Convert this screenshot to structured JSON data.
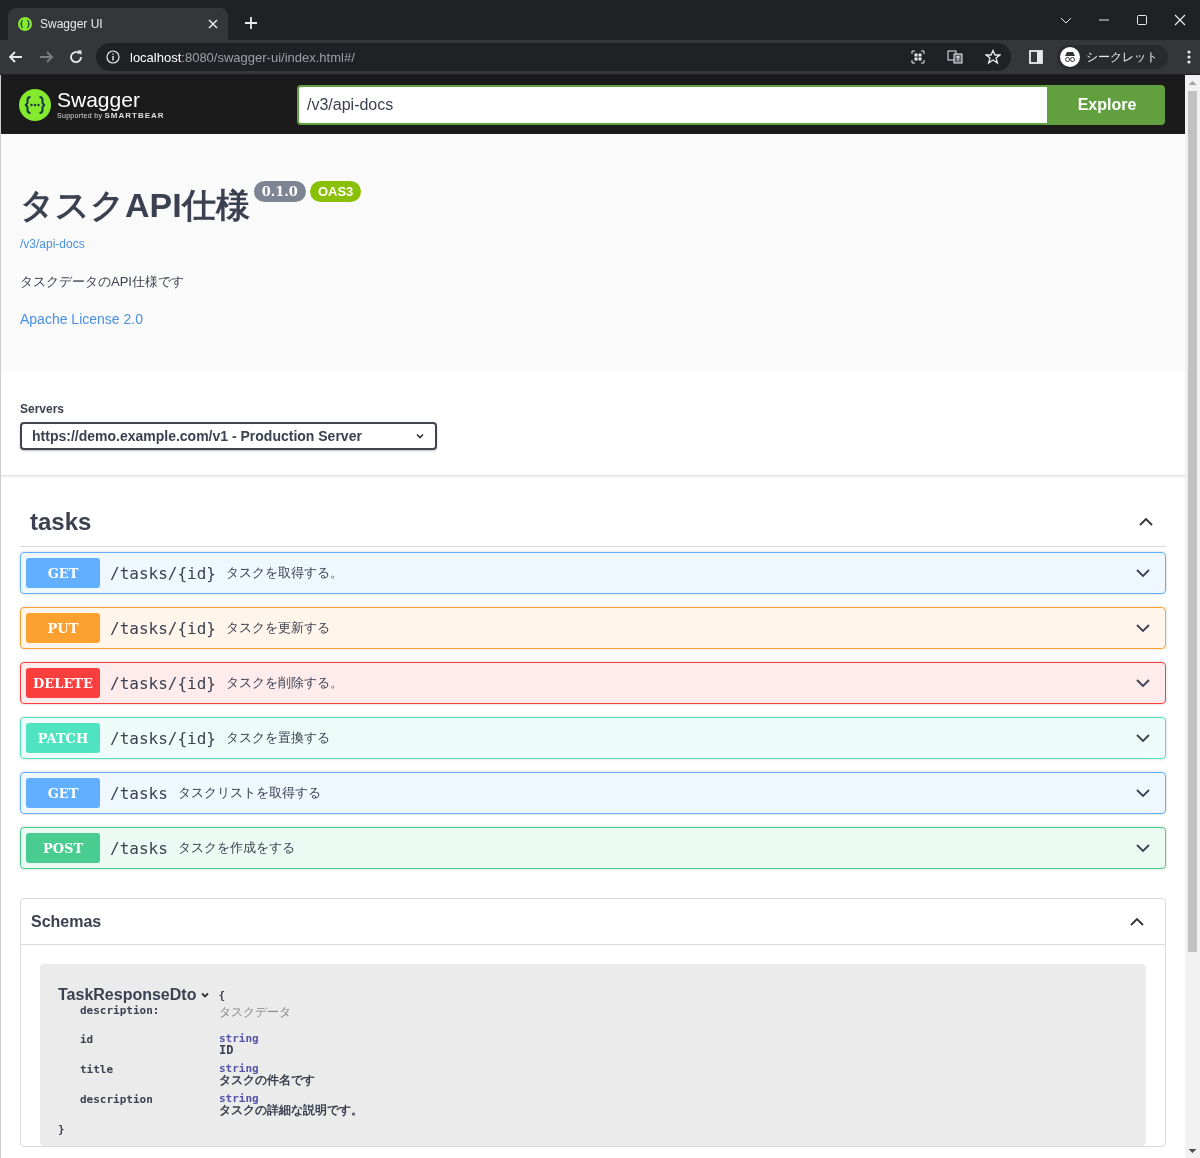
{
  "browser": {
    "tabs": [
      {
        "title": "Swagger UI",
        "selected": true
      }
    ],
    "url": {
      "host": "localhost",
      "path": ":8080/swagger-ui/index.html#/"
    },
    "profile_label": "シークレット"
  },
  "topbar": {
    "logo_text": "Swagger",
    "logo_sub": "Supported by",
    "logo_brand": "SMARTBEAR",
    "url_value": "/v3/api-docs",
    "button": "Explore"
  },
  "info": {
    "title": "タスクAPI仕様",
    "version": "0.1.0",
    "oas": "OAS3",
    "spec_link": "/v3/api-docs",
    "description": "タスクデータのAPI仕様です",
    "license": "Apache License 2.0"
  },
  "servers": {
    "label": "Servers",
    "selected": "https://demo.example.com/v1 - Production Server"
  },
  "tags": [
    {
      "name": "tasks",
      "expanded": true,
      "operations": [
        {
          "method": "GET",
          "color": "#61affe",
          "path": "/tasks/{id}",
          "summary": "タスクを取得する。"
        },
        {
          "method": "PUT",
          "color": "#fca130",
          "path": "/tasks/{id}",
          "summary": "タスクを更新する"
        },
        {
          "method": "DELETE",
          "color": "#f93e3e",
          "path": "/tasks/{id}",
          "summary": "タスクを削除する。"
        },
        {
          "method": "PATCH",
          "color": "#50e3c2",
          "path": "/tasks/{id}",
          "summary": "タスクを置換する"
        },
        {
          "method": "GET",
          "color": "#61affe",
          "path": "/tasks",
          "summary": "タスクリストを取得する"
        },
        {
          "method": "POST",
          "color": "#49cc90",
          "path": "/tasks",
          "summary": "タスクを作成をする"
        }
      ]
    }
  ],
  "schemas": {
    "title": "Schemas",
    "expanded": true,
    "models": [
      {
        "name": "TaskResponseDto",
        "expanded": true,
        "open": "{",
        "close": "}",
        "description_label": "description:",
        "description": "タスクデータ",
        "properties": [
          {
            "name": "id",
            "type": "string",
            "description": "ID"
          },
          {
            "name": "title",
            "type": "string",
            "description": "タスクの件名です"
          },
          {
            "name": "description",
            "type": "string",
            "description": "タスクの詳細な説明です。"
          }
        ]
      }
    ]
  }
}
